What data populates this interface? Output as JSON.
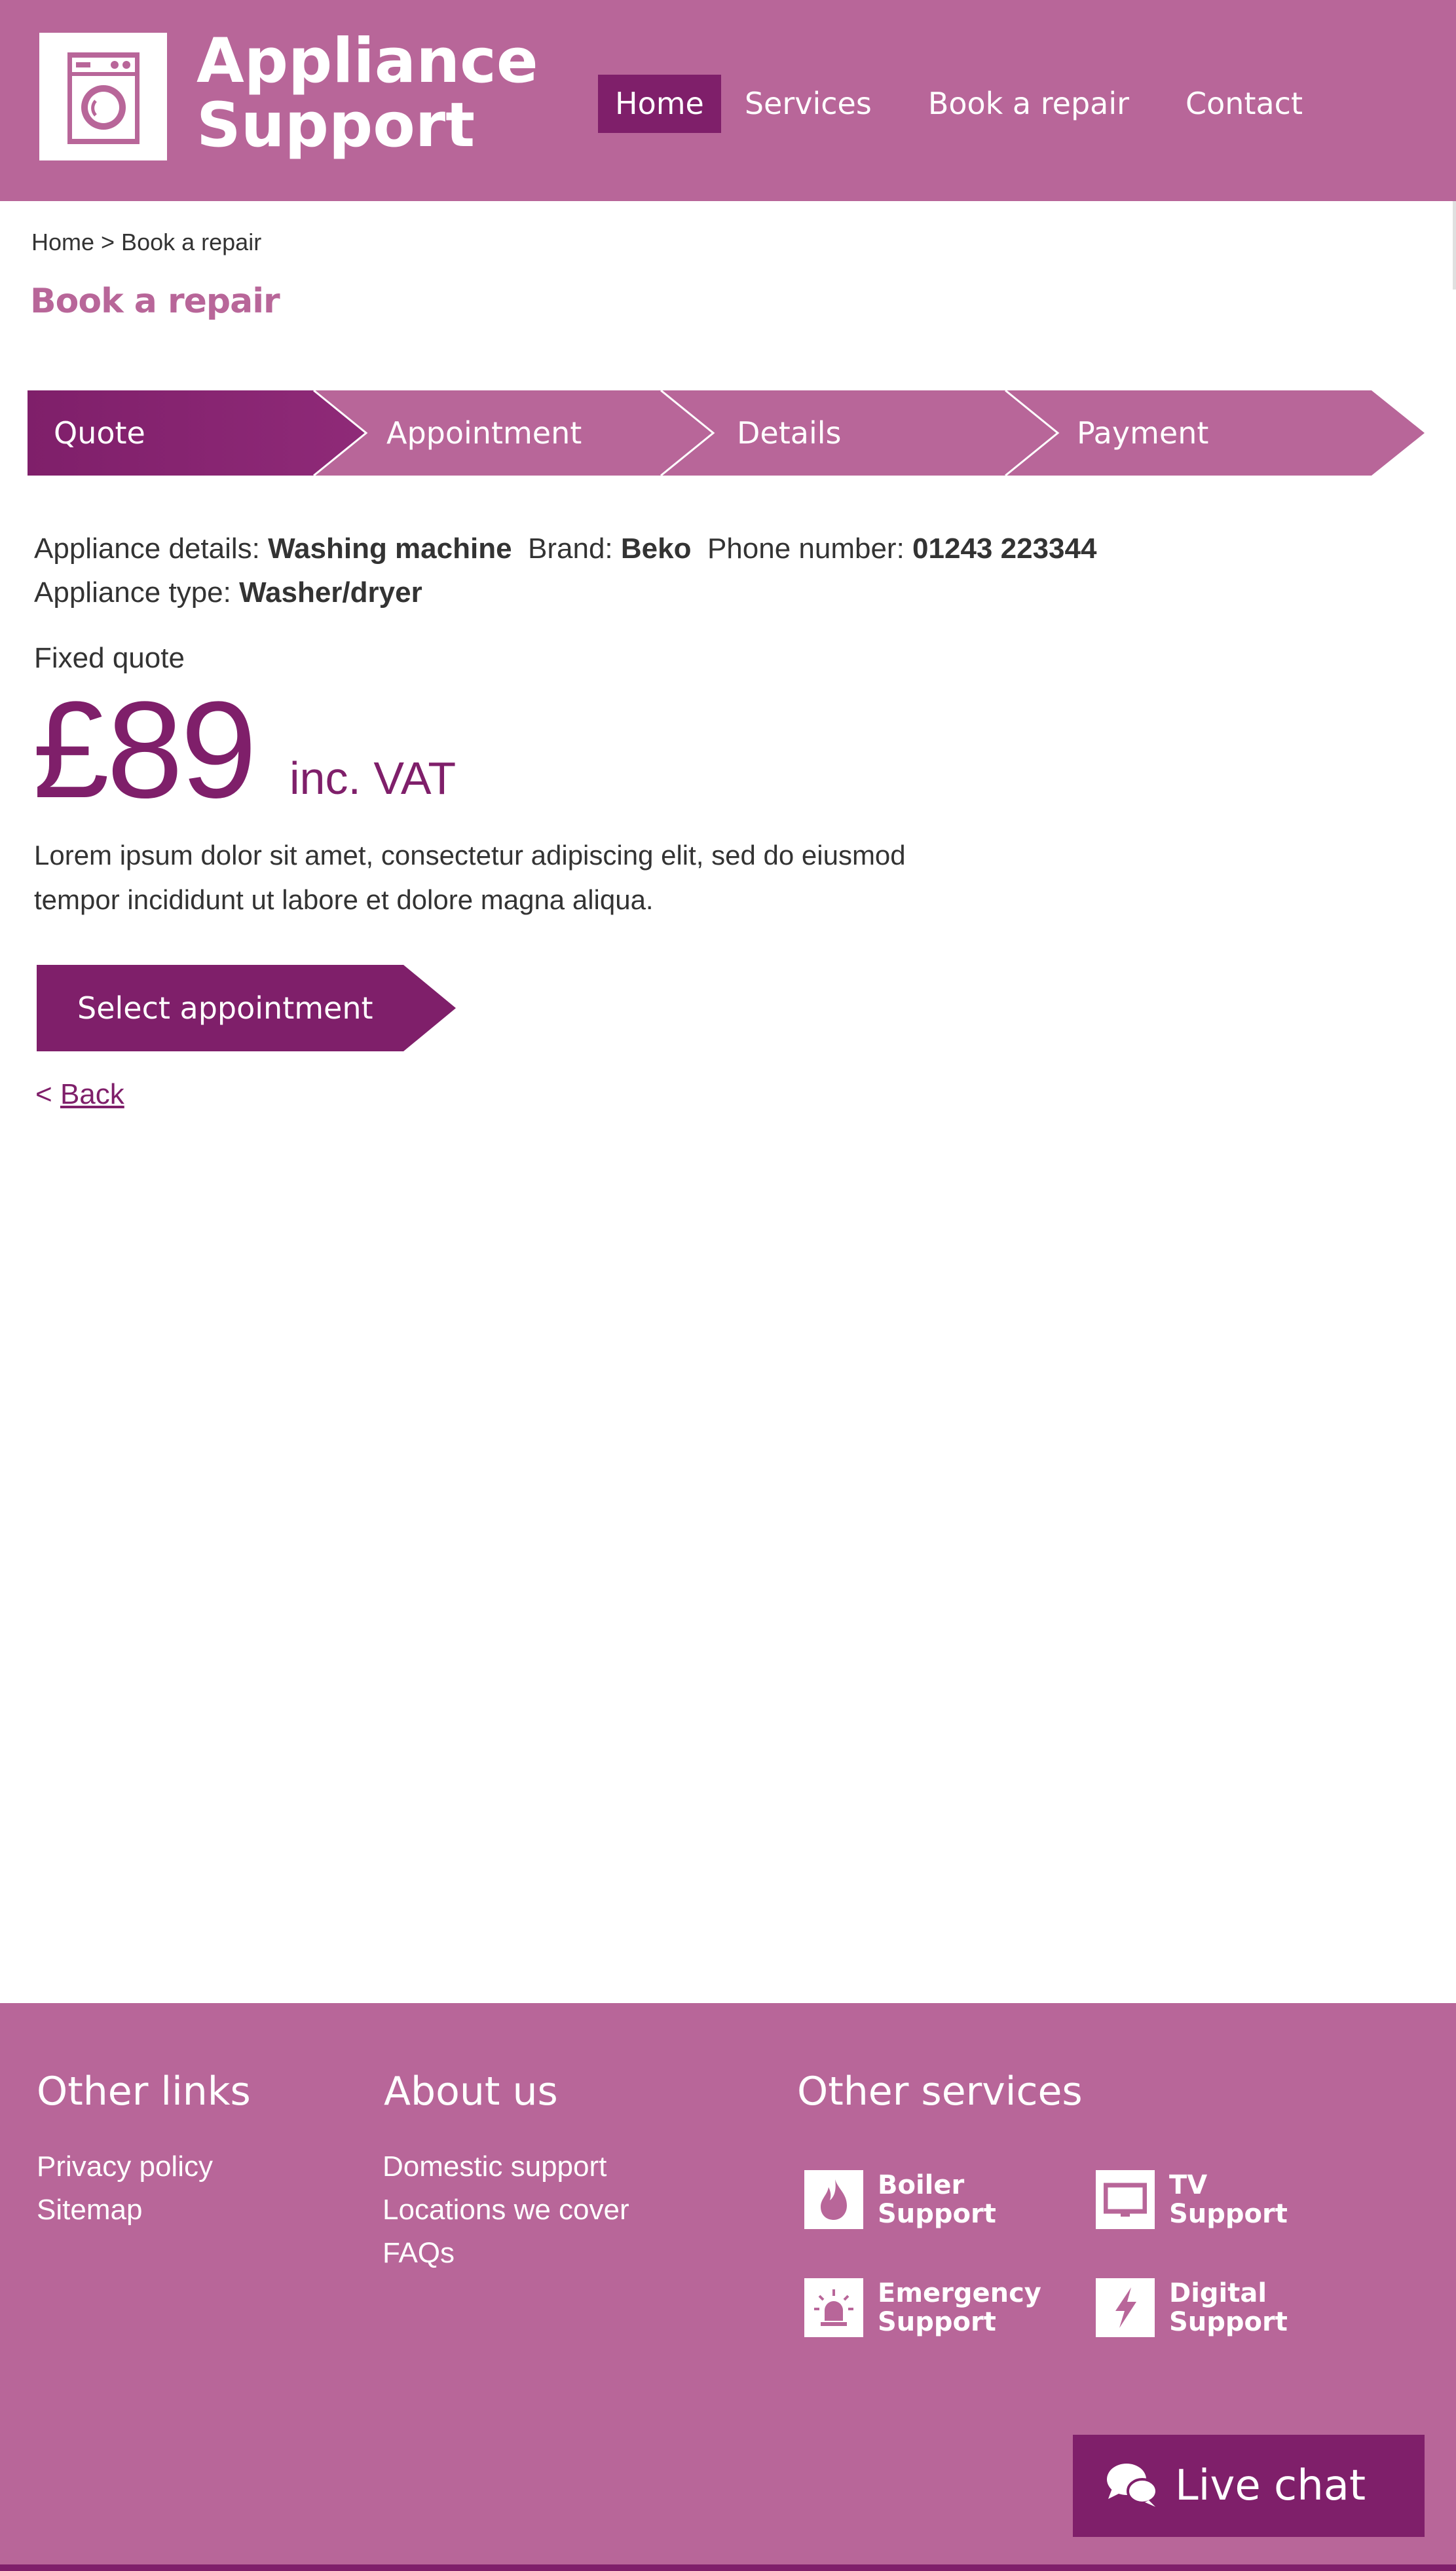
{
  "header": {
    "title_line1": "Appliance",
    "title_line2": "Support",
    "logo_icon": "washing-machine-icon",
    "nav": [
      {
        "label": "Home",
        "active": true
      },
      {
        "label": "Services",
        "active": false
      },
      {
        "label": "Book a repair",
        "active": false
      },
      {
        "label": "Contact",
        "active": false
      }
    ]
  },
  "breadcrumb": "Home > Book a repair",
  "page_title": "Book a repair",
  "steps": [
    {
      "label": "Quote",
      "active": true
    },
    {
      "label": "Appointment",
      "active": false
    },
    {
      "label": "Details",
      "active": false
    },
    {
      "label": "Payment",
      "active": false
    }
  ],
  "details": {
    "appliance_label": "Appliance details:",
    "appliance_value": "Washing machine",
    "brand_label": "Brand:",
    "brand_value": "Beko",
    "phone_label": "Phone number:",
    "phone_value": "01243 223344",
    "type_label": "Appliance type:",
    "type_value": "Washer/dryer"
  },
  "quote": {
    "heading": "Fixed quote",
    "price": "£89",
    "vat": "inc. VAT",
    "description": "Lorem ipsum dolor sit amet, consectetur adipiscing elit, sed do eiusmod tempor incididunt ut labore et dolore magna aliqua."
  },
  "actions": {
    "select_label": "Select appointment",
    "back_prefix": "<",
    "back_label": "Back"
  },
  "footer": {
    "other_links": {
      "heading": "Other links",
      "links": [
        "Privacy policy",
        "Sitemap"
      ]
    },
    "about_us": {
      "heading": "About us",
      "links": [
        "Domestic support",
        "Locations we cover",
        "FAQs"
      ]
    },
    "other_services": {
      "heading": "Other services",
      "items": [
        {
          "line1": "Boiler",
          "line2": "Support",
          "icon": "flame-icon"
        },
        {
          "line1": "TV",
          "line2": "Support",
          "icon": "tv-icon"
        },
        {
          "line1": "Emergency",
          "line2": "Support",
          "icon": "siren-icon"
        },
        {
          "line1": "Digital",
          "line2": "Support",
          "icon": "lightning-icon"
        }
      ]
    },
    "live_chat": "Live chat"
  },
  "colors": {
    "brand": "#b86699",
    "accent": "#7f1f6a",
    "text": "#333333"
  }
}
